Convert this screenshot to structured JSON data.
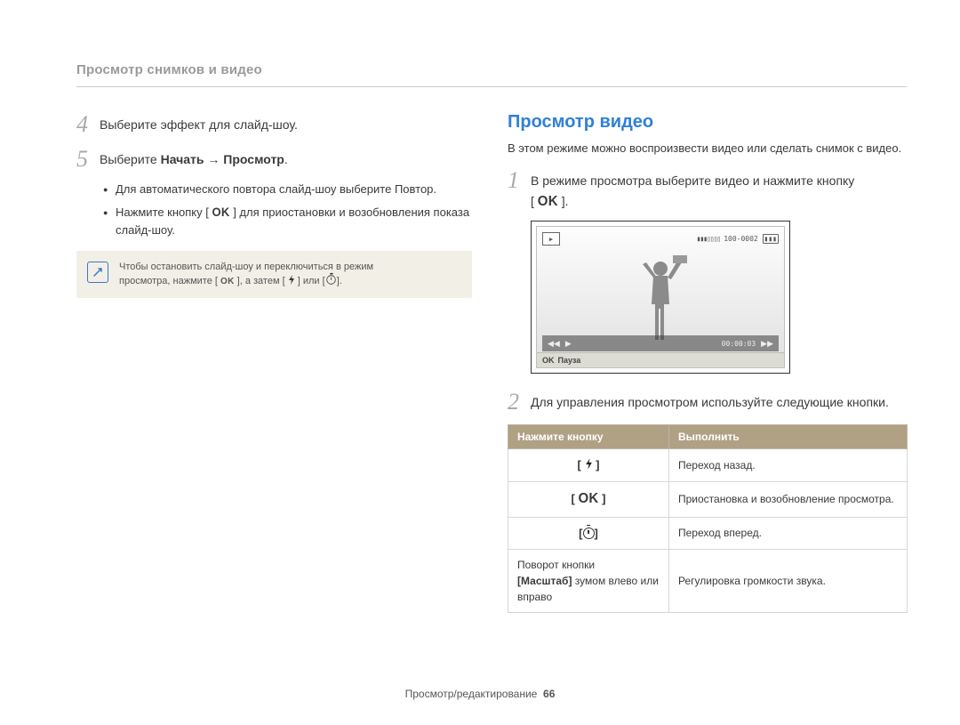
{
  "section_title": "Просмотр снимков и видео",
  "left": {
    "steps": [
      {
        "num": "4",
        "text_prefix": "Выберите эффект для слайд-шоу.",
        "bold": ""
      },
      {
        "num": "5",
        "text_prefix": "Выберите ",
        "bold": "Начать → Просмотр"
      }
    ],
    "bullets": {
      "b1_text": "Для автоматического повтора слайд-шоу выберите ",
      "b1_bold": "Повтор",
      "b1_suffix": ".",
      "b2_prefix": "Нажмите кнопку [ ",
      "b2_mid": " ] для приостановки и возобновления показа слайд-шоу."
    },
    "note": {
      "line1": "Чтобы остановить слайд-шоу и переключиться в режим",
      "line2_a": "просмотра, нажмите [ ",
      "line2_b": " ], а затем [ ",
      "line2_c": " ] или [",
      "line2_d": "]."
    }
  },
  "right": {
    "heading": "Просмотр видео",
    "intro": "В этом режиме можно воспроизвести видео или сделать снимок с видео.",
    "step1_a": "В режиме просмотра выберите видео и нажмите кнопку",
    "step1_b": "[ ",
    "step1_c": " ].",
    "video": {
      "file_id": "100-0002",
      "time": "00:00:03",
      "bottom_label": "Пауза"
    },
    "step2": "Для управления просмотром используйте следующие кнопки.",
    "table": {
      "th1": "Нажмите кнопку",
      "th2": "Выполнить",
      "rows": [
        {
          "btn_kind": "flash",
          "action": "Переход назад."
        },
        {
          "btn_kind": "ok",
          "action": "Приостановка и возобновление просмотра."
        },
        {
          "btn_kind": "timer",
          "action": "Переход вперед."
        },
        {
          "btn_kind": "zoom",
          "label_a": "Поворот кнопки",
          "label_b": "[Масштаб]",
          "label_c": " зумом влево или вправо",
          "action": "Регулировка громкости звука."
        }
      ]
    }
  },
  "footer": {
    "text": "Просмотр/редактирование",
    "page": "66"
  },
  "chart_data": {
    "type": "table",
    "title": "Управление просмотром видео",
    "columns": [
      "Нажмите кнопку",
      "Выполнить"
    ],
    "rows": [
      [
        "[ ⚡ ]",
        "Переход назад."
      ],
      [
        "[ OK ]",
        "Приостановка и возобновление просмотра."
      ],
      [
        "[ ⏲ ]",
        "Переход вперед."
      ],
      [
        "Поворот кнопки [Масштаб] зумом влево или вправо",
        "Регулировка громкости звука."
      ]
    ]
  }
}
